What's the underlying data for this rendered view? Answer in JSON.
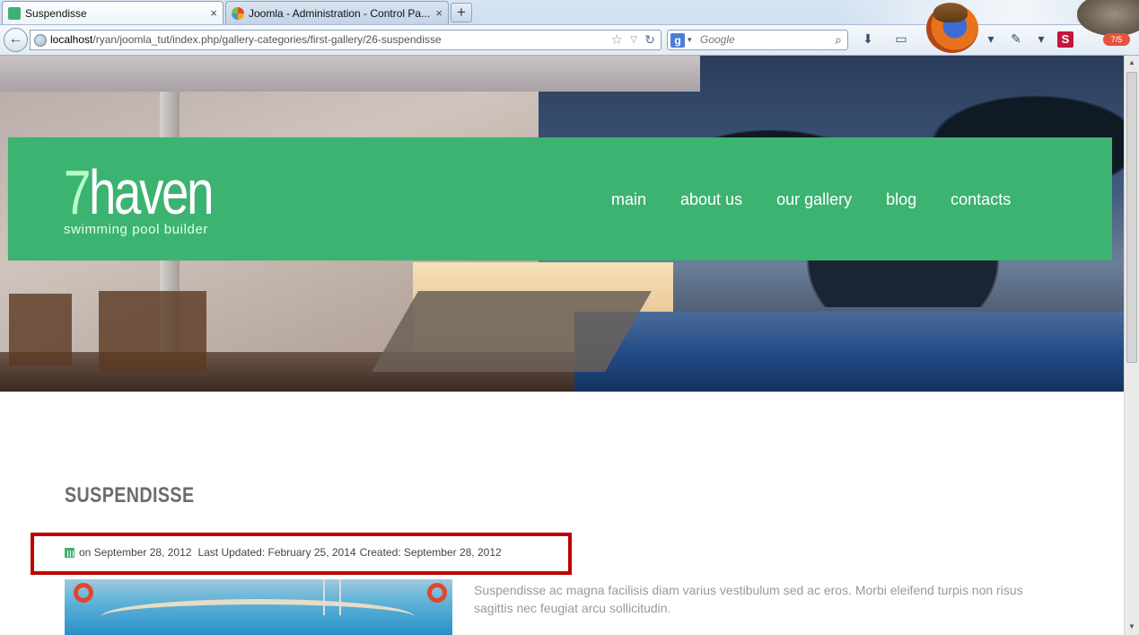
{
  "browser": {
    "tabs": [
      {
        "title": "Suspendisse",
        "active": true
      },
      {
        "title": "Joomla - Administration - Control Pa...",
        "active": false
      }
    ],
    "new_tab_label": "+",
    "close_label": "×",
    "url_host": "localhost",
    "url_path": "/ryan/joomla_tut/index.php/gallery-categories/first-gallery/26-suspendisse",
    "search_placeholder": "Google",
    "badge_letter": "S",
    "badge_count": "7/5"
  },
  "site": {
    "logo_first": "7",
    "logo_rest": "haven",
    "tagline": "swimming pool builder",
    "brand_color": "#3cb371",
    "menu": [
      "main",
      "about us",
      "our gallery",
      "blog",
      "contacts"
    ]
  },
  "article": {
    "title": "SUSPENDISSE",
    "published": "on September 28, 2012",
    "updated": "Last Updated: February 25, 2014",
    "created": "Created: September 28, 2012",
    "excerpt": "Suspendisse ac magna facilisis diam varius vestibulum sed ac eros. Morbi eleifend turpis non risus sagittis nec feugiat arcu sollicitudin.",
    "highlight_color": "#c00000"
  }
}
